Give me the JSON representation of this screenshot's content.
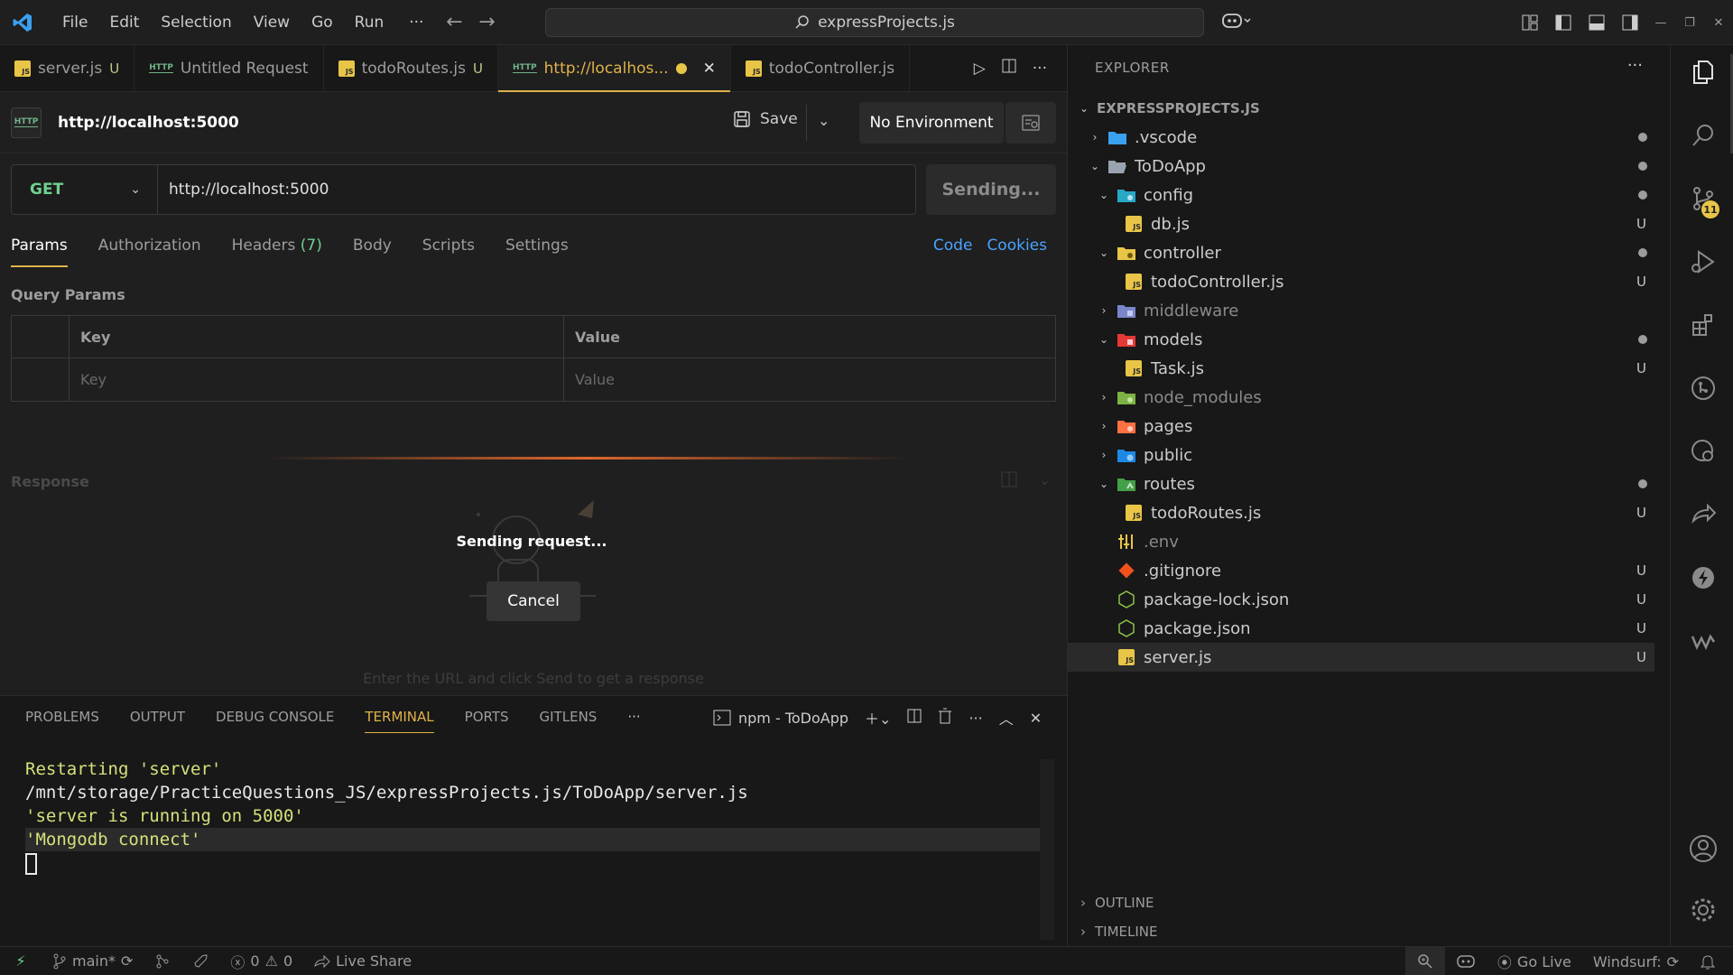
{
  "titlebar": {
    "menu": [
      "File",
      "Edit",
      "Selection",
      "View",
      "Go",
      "Run"
    ],
    "more": "···",
    "search_text": "expressProjects.js"
  },
  "tabs": [
    {
      "label": "server.js",
      "status": "U",
      "type": "js"
    },
    {
      "label": "Untitled Request",
      "status": "",
      "type": "http"
    },
    {
      "label": "todoRoutes.js",
      "status": "U",
      "type": "js"
    },
    {
      "label": "http://localhos...",
      "status": "",
      "type": "http",
      "active": true
    },
    {
      "label": "todoController.js",
      "status": "",
      "type": "js"
    }
  ],
  "request": {
    "title": "http://localhost:5000",
    "save_label": "Save",
    "environment": "No Environment",
    "method": "GET",
    "url": "http://localhost:5000",
    "send_label": "Sending...",
    "tabs": {
      "params": "Params",
      "authorization": "Authorization",
      "headers": "Headers",
      "headers_count": "(7)",
      "body": "Body",
      "scripts": "Scripts",
      "settings": "Settings"
    },
    "links": {
      "code": "Code",
      "cookies": "Cookies"
    },
    "query_params_label": "Query Params",
    "table": {
      "key_header": "Key",
      "value_header": "Value",
      "key_placeholder": "Key",
      "value_placeholder": "Value"
    }
  },
  "response": {
    "label": "Response",
    "sending_text": "Sending request...",
    "cancel_label": "Cancel",
    "hint": "Enter the URL and click Send to get a response"
  },
  "terminal": {
    "tabs": [
      "PROBLEMS",
      "OUTPUT",
      "DEBUG CONSOLE",
      "TERMINAL",
      "PORTS",
      "GITLENS"
    ],
    "active_tab": "TERMINAL",
    "more": "···",
    "instance": "npm - ToDoApp",
    "lines": [
      "Restarting 'server'",
      "/mnt/storage/PracticeQuestions_JS/expressProjects.js/ToDoApp/server.js",
      "'server is running on 5000'",
      "'Mongodb connect'"
    ]
  },
  "explorer": {
    "header": "EXPLORER",
    "more": "···",
    "root": "EXPRESSPROJECTS.JS",
    "items": [
      {
        "name": ".vscode",
        "chev": "right",
        "status": "dot"
      },
      {
        "name": "ToDoApp",
        "chev": "down",
        "status": "dot"
      },
      {
        "name": "config",
        "chev": "down",
        "status": "dot"
      },
      {
        "name": "db.js",
        "chev": "",
        "status": "U"
      },
      {
        "name": "controller",
        "chev": "down",
        "status": "dot"
      },
      {
        "name": "todoController.js",
        "chev": "",
        "status": "U"
      },
      {
        "name": "middleware",
        "chev": "right",
        "status": ""
      },
      {
        "name": "models",
        "chev": "down",
        "status": "dot"
      },
      {
        "name": "Task.js",
        "chev": "",
        "status": "U"
      },
      {
        "name": "node_modules",
        "chev": "right",
        "status": ""
      },
      {
        "name": "pages",
        "chev": "right",
        "status": ""
      },
      {
        "name": "public",
        "chev": "right",
        "status": ""
      },
      {
        "name": "routes",
        "chev": "down",
        "status": "dot"
      },
      {
        "name": "todoRoutes.js",
        "chev": "",
        "status": "U"
      },
      {
        "name": ".env",
        "chev": "",
        "status": ""
      },
      {
        "name": ".gitignore",
        "chev": "",
        "status": "U"
      },
      {
        "name": "package-lock.json",
        "chev": "",
        "status": "U"
      },
      {
        "name": "package.json",
        "chev": "",
        "status": "U"
      },
      {
        "name": "server.js",
        "chev": "",
        "status": "U"
      }
    ],
    "outline": "OUTLINE",
    "timeline": "TIMELINE"
  },
  "activity": {
    "scm_badge": "11"
  },
  "statusbar": {
    "branch": "main*",
    "errors": "0",
    "warnings": "0",
    "live_share": "Live Share",
    "go_live": "Go Live",
    "windsurf": "Windsurf:"
  },
  "colors": {
    "accent": "#e0b14a",
    "method_get": "#6fd18f",
    "link": "#4aa3ff",
    "terminal_text": "#d7e07b"
  }
}
